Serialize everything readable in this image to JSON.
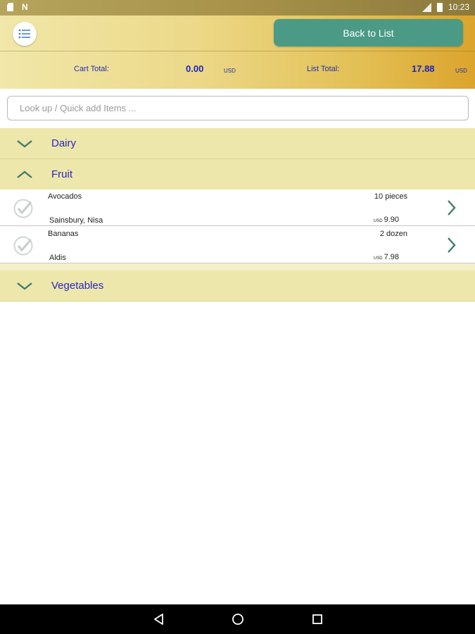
{
  "status_bar": {
    "time": "10:23",
    "left_icons": [
      "sim-card-icon",
      "notification-n-icon"
    ],
    "right_icons": [
      "signal-icon",
      "battery-icon"
    ]
  },
  "header": {
    "menu_icon": "list-icon",
    "back_button_label": "Back to List",
    "cart_total_label": "Cart Total:",
    "cart_total_value": "0.00",
    "cart_currency": "USD",
    "list_total_label": "List Total:",
    "list_total_value": "17.88",
    "list_currency": "USD"
  },
  "search": {
    "placeholder": "Look up / Quick add Items ...",
    "value": ""
  },
  "categories": [
    {
      "label": "Dairy",
      "expanded": false
    },
    {
      "label": "Fruit",
      "expanded": true,
      "items": [
        {
          "name": "Avocados",
          "quantity": "10 pieces",
          "stores": "Sainsbury, Nisa",
          "currency": "USD",
          "price": "9.90"
        },
        {
          "name": "Bananas",
          "quantity": "2 dozen",
          "stores": "Aldis",
          "currency": "USD",
          "price": "7.98"
        }
      ]
    },
    {
      "label": "Vegetables",
      "expanded": false
    }
  ],
  "colors": {
    "accent_button": "#4b9a86",
    "category_bg": "#ede7ac",
    "category_text": "#2626c0",
    "totals_text": "#1a24c8",
    "chevron": "#3e7c6e"
  },
  "nav_bar": {
    "icons": [
      "back-icon",
      "home-icon",
      "recents-icon"
    ]
  }
}
